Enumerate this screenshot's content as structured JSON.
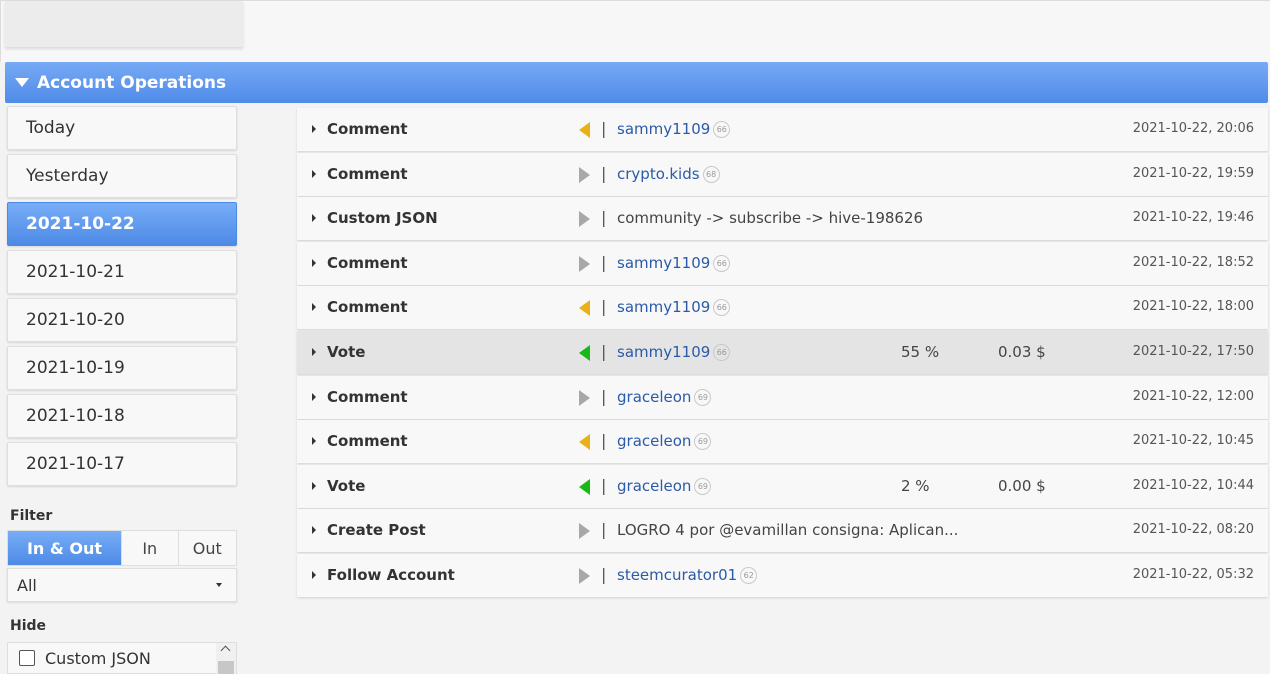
{
  "section": {
    "title": "Account Operations"
  },
  "dates": [
    "Today",
    "Yesterday",
    "2021-10-22",
    "2021-10-21",
    "2021-10-20",
    "2021-10-19",
    "2021-10-18",
    "2021-10-17"
  ],
  "filter": {
    "label": "Filter",
    "options": [
      "In & Out",
      "In",
      "Out"
    ],
    "select_value": "All"
  },
  "hide": {
    "label": "Hide",
    "item": "Custom JSON"
  },
  "operations": [
    {
      "type": "Comment",
      "direction": "in",
      "who": "sammy1109",
      "rep": "66",
      "pct": "",
      "value": "",
      "time": "2021-10-22, 20:06"
    },
    {
      "type": "Comment",
      "direction": "out",
      "who": "crypto.kids",
      "rep": "68",
      "pct": "",
      "value": "",
      "time": "2021-10-22, 19:59"
    },
    {
      "type": "Custom JSON",
      "direction": "out",
      "who": "community -> subscribe -> hive-198626",
      "rep": "",
      "pct": "",
      "value": "",
      "time": "2021-10-22, 19:46"
    },
    {
      "type": "Comment",
      "direction": "out",
      "who": "sammy1109",
      "rep": "66",
      "pct": "",
      "value": "",
      "time": "2021-10-22, 18:52"
    },
    {
      "type": "Comment",
      "direction": "in",
      "who": "sammy1109",
      "rep": "66",
      "pct": "",
      "value": "",
      "time": "2021-10-22, 18:00"
    },
    {
      "type": "Vote",
      "direction": "in-vote",
      "who": "sammy1109",
      "rep": "66",
      "pct": "55 %",
      "value": "0.03 $",
      "time": "2021-10-22, 17:50"
    },
    {
      "type": "Comment",
      "direction": "out",
      "who": "graceleon",
      "rep": "69",
      "pct": "",
      "value": "",
      "time": "2021-10-22, 12:00"
    },
    {
      "type": "Comment",
      "direction": "in",
      "who": "graceleon",
      "rep": "69",
      "pct": "",
      "value": "",
      "time": "2021-10-22, 10:45"
    },
    {
      "type": "Vote",
      "direction": "in-vote",
      "who": "graceleon",
      "rep": "69",
      "pct": "2 %",
      "value": "0.00 $",
      "time": "2021-10-22, 10:44"
    },
    {
      "type": "Create Post",
      "direction": "out",
      "who": "LOGRO 4 por @evamillan consigna: Aplican...",
      "rep": "",
      "pct": "",
      "value": "",
      "time": "2021-10-22, 08:20"
    },
    {
      "type": "Follow Account",
      "direction": "out",
      "who": "steemcurator01",
      "rep": "62",
      "pct": "",
      "value": "",
      "time": "2021-10-22, 05:32"
    }
  ]
}
